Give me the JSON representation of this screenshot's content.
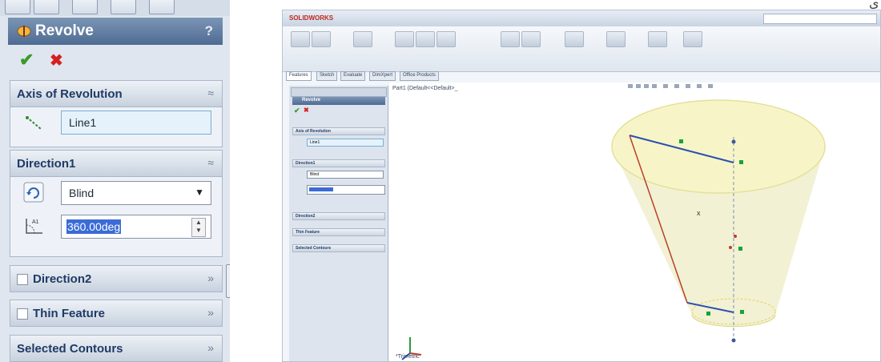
{
  "left_panel": {
    "feature_title": "Revolve",
    "help_label": "?",
    "ok_glyph": "✔",
    "cancel_glyph": "✖",
    "sections": {
      "axis": {
        "label": "Axis of Revolution",
        "value": "Line1"
      },
      "direction1": {
        "label": "Direction1",
        "end_condition": "Blind",
        "angle": "360.00deg"
      },
      "direction2": {
        "label": "Direction2"
      },
      "thin": {
        "label": "Thin Feature"
      },
      "contours": {
        "label": "Selected Contours"
      }
    },
    "colors": {
      "title_bar": "#5a769c",
      "section_text": "#1f3a66",
      "ok": "#3a9a2a",
      "cancel": "#d42020"
    }
  },
  "app_window": {
    "app_name": "SOLIDWORKS",
    "doc_title": "",
    "tabs": [
      "Features",
      "Sketch",
      "Evaluate",
      "DimXpert",
      "Office Products"
    ],
    "tree_root": "Part1 (Default<<Default>_",
    "pm_title": "Revolve",
    "pm_sections": [
      "Axis of Revolution",
      "Direction1",
      "Direction2",
      "Thin Feature",
      "Selected Contours"
    ],
    "pm_axis_value": "Line1",
    "pm_end_condition": "Blind",
    "view_label": "*Trimetric"
  },
  "corner_glyph": "ى"
}
